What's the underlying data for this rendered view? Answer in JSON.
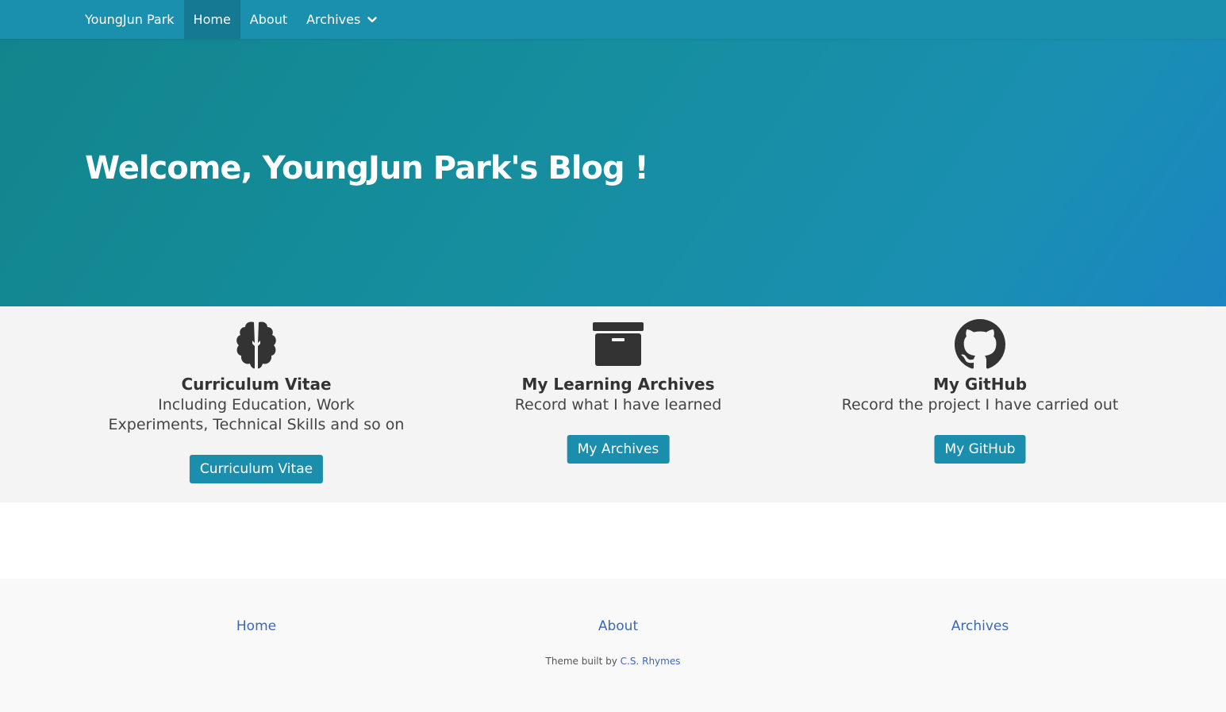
{
  "navbar": {
    "brand": "YoungJun Park",
    "items": [
      {
        "label": "Home",
        "active": true
      },
      {
        "label": "About",
        "active": false
      },
      {
        "label": "Archives",
        "active": false,
        "dropdown": true
      }
    ]
  },
  "hero": {
    "title": "Welcome, YoungJun Park's Blog !"
  },
  "features": [
    {
      "icon": "brain-icon",
      "title": "Curriculum Vitae",
      "description": "Including Education, Work Experiments, Technical Skills and so on",
      "button": "Curriculum Vitae"
    },
    {
      "icon": "archive-box-icon",
      "title": "My Learning Archives",
      "description": "Record what I have learned",
      "button": "My Archives"
    },
    {
      "icon": "github-icon",
      "title": "My GitHub",
      "description": "Record the project I have carried out",
      "button": "My GitHub"
    }
  ],
  "footer": {
    "links": [
      "Home",
      "About",
      "Archives"
    ],
    "credit_prefix": "Theme built by ",
    "credit_link": "C.S. Rhymes"
  },
  "colors": {
    "nav": "#1b8fae",
    "nav_active": "#167994",
    "hero_start": "#11858c",
    "hero_end": "#1a86c2",
    "button": "#1b8ead",
    "link": "#3d68b5",
    "feature_bg": "#f4f4f4"
  }
}
